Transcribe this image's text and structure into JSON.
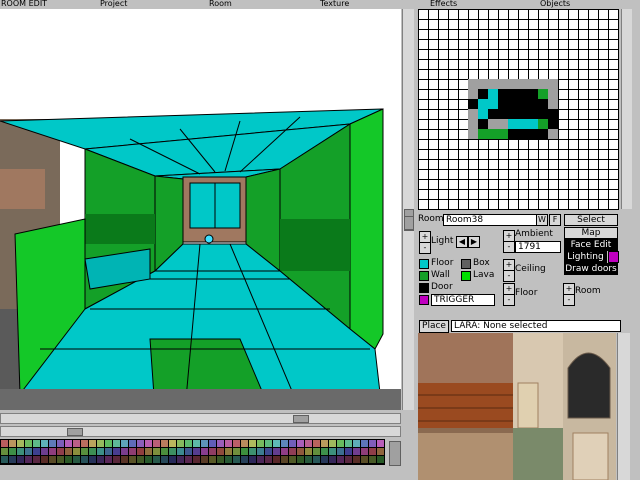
{
  "menu": {
    "room_edit": "ROOM EDIT",
    "project": "Project",
    "room": "Room",
    "texture": "Texture",
    "effects": "Effects",
    "objects": "Objects"
  },
  "room_panel": {
    "room_label": "Room:",
    "room_name": "Room38",
    "w_btn": "W",
    "f_btn": "F",
    "light_label": "Light",
    "ambient_label": "Ambient",
    "ambient_value": "1791",
    "ceiling_label": "Ceiling",
    "floor_label": "Floor",
    "room_label2": "Room",
    "plus": "+",
    "minus": "-"
  },
  "modes": {
    "select": "Select",
    "map": "Map",
    "face_edit": "Face Edit",
    "lighting": "Lighting",
    "draw_doors": "Draw doors"
  },
  "legend": {
    "floor": "Floor",
    "box": "Box",
    "wall": "Wall",
    "lava": "Lava",
    "door": "Door",
    "trigger": "TRIGGER"
  },
  "lara_bar": {
    "place": "Place",
    "status": "LARA: None selected"
  },
  "colors": {
    "floor": "#00c8c8",
    "wall": "#14a028",
    "lava": "#00e000",
    "box": "#606060",
    "trigger": "#c000c0"
  }
}
